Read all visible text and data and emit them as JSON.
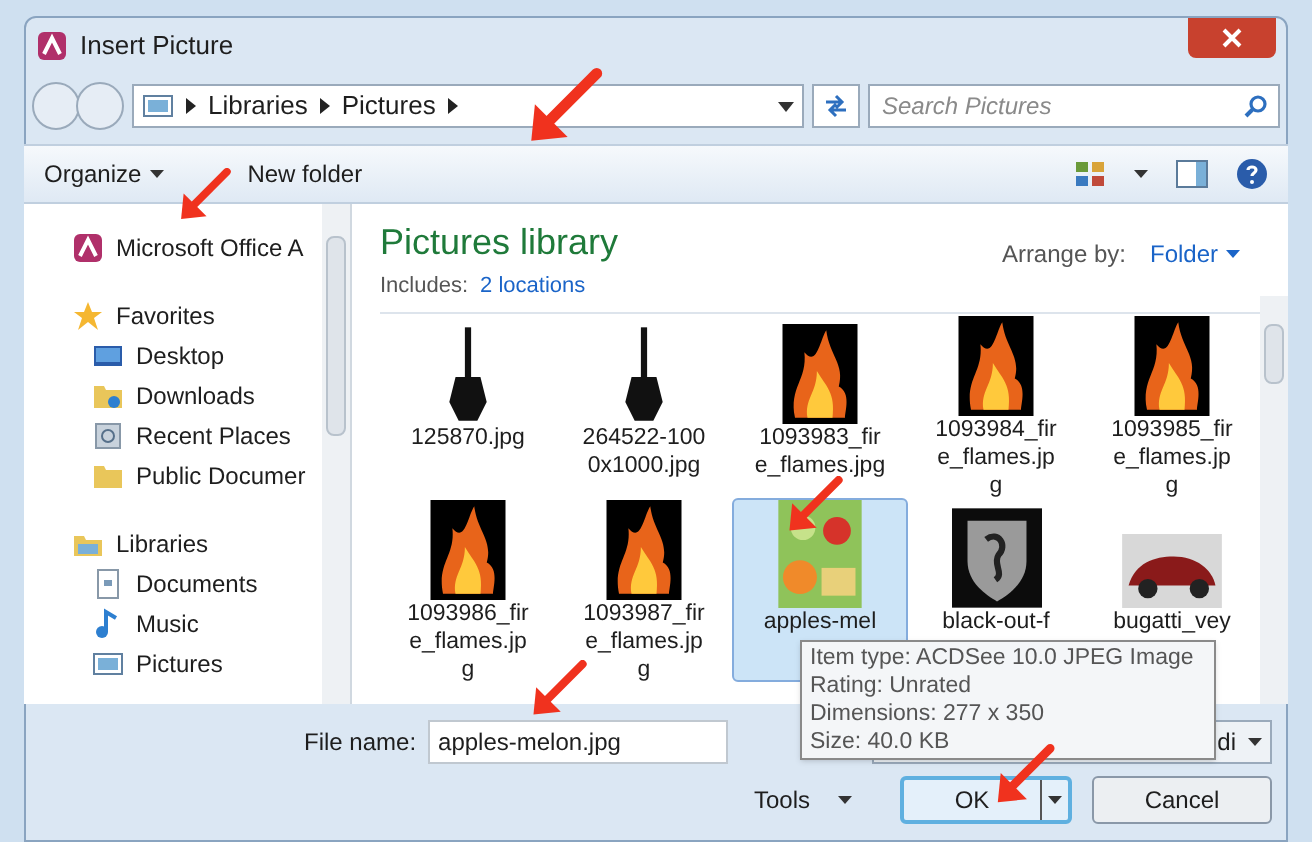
{
  "window": {
    "title": "Insert Picture"
  },
  "address": {
    "crumbs": [
      "Libraries",
      "Pictures"
    ],
    "search_placeholder": "Search Pictures"
  },
  "toolbar": {
    "organize": "Organize",
    "new_folder": "New folder"
  },
  "nav": [
    {
      "label": "Microsoft Office A",
      "kind": "office"
    },
    {
      "label": "Favorites",
      "kind": "star",
      "children": [
        {
          "label": "Desktop",
          "kind": "desktop"
        },
        {
          "label": "Downloads",
          "kind": "downloads"
        },
        {
          "label": "Recent Places",
          "kind": "recent"
        },
        {
          "label": "Public Documer",
          "kind": "folder"
        }
      ]
    },
    {
      "label": "Libraries",
      "kind": "library",
      "children": [
        {
          "label": "Documents",
          "kind": "document"
        },
        {
          "label": "Music",
          "kind": "music"
        },
        {
          "label": "Pictures",
          "kind": "pictures"
        }
      ]
    }
  ],
  "library": {
    "title": "Pictures library",
    "includes_label": "Includes:",
    "includes_link": "2 locations",
    "arrange_label": "Arrange by:",
    "arrange_value": "Folder"
  },
  "files": [
    {
      "lines": [
        "125870.jpg"
      ],
      "kind": "guitar",
      "selected": false
    },
    {
      "lines": [
        "264522-100",
        "0x1000.jpg"
      ],
      "kind": "guitar",
      "selected": false
    },
    {
      "lines": [
        "1093983_fir",
        "e_flames.jpg"
      ],
      "kind": "fire",
      "selected": false
    },
    {
      "lines": [
        "1093984_fir",
        "e_flames.jp",
        "g"
      ],
      "kind": "fire",
      "selected": false
    },
    {
      "lines": [
        "1093985_fir",
        "e_flames.jp",
        "g"
      ],
      "kind": "fire",
      "selected": false
    },
    {
      "lines": [
        "1093986_fir",
        "e_flames.jp",
        "g"
      ],
      "kind": "fire",
      "selected": false
    },
    {
      "lines": [
        "1093987_fir",
        "e_flames.jp",
        "g"
      ],
      "kind": "fire",
      "selected": false
    },
    {
      "lines": [
        "apples-mel"
      ],
      "kind": "produce",
      "selected": true
    },
    {
      "lines": [
        "black-out-f"
      ],
      "kind": "emblem",
      "selected": false
    },
    {
      "lines": [
        "bugatti_vey"
      ],
      "kind": "car",
      "selected": false
    }
  ],
  "tooltip": [
    "Item type: ACDSee 10.0 JPEG Image",
    "Rating: Unrated",
    "Dimensions: 277 x 350",
    "Size: 40.0 KB"
  ],
  "bottom": {
    "file_name_label": "File name:",
    "file_name_value": "apples-melon.jpg",
    "file_type": "di",
    "tools": "Tools",
    "ok": "OK",
    "cancel": "Cancel"
  }
}
